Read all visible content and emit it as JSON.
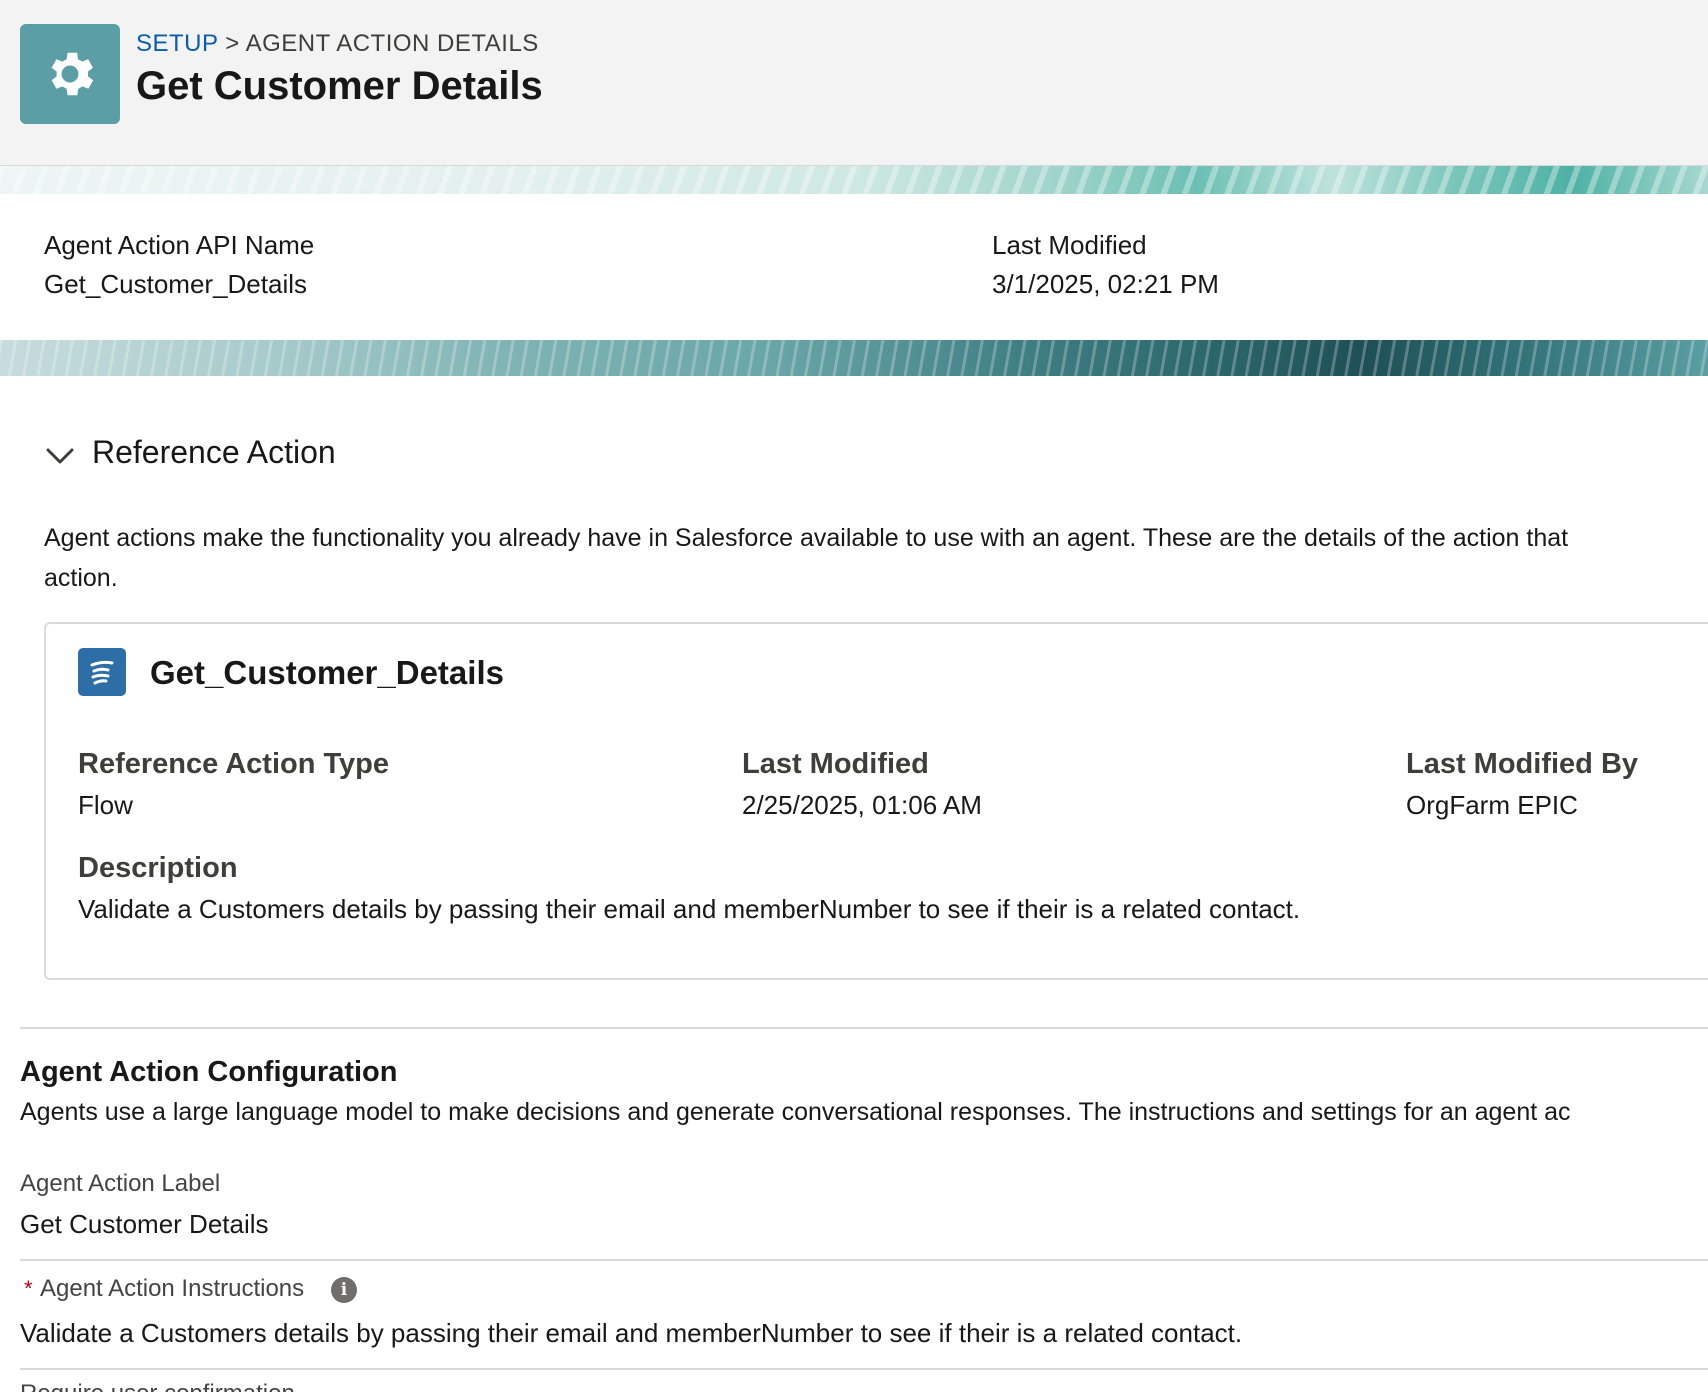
{
  "header": {
    "breadcrumb_link": "SETUP",
    "breadcrumb_separator": ">",
    "breadcrumb_current": "AGENT ACTION DETAILS",
    "title": "Get Customer Details",
    "icon": "gear-icon"
  },
  "summary": {
    "api_name_label": "Agent Action API Name",
    "api_name_value": "Get_Customer_Details",
    "last_modified_label": "Last Modified",
    "last_modified_value": "3/1/2025, 02:21 PM"
  },
  "reference_section": {
    "title": "Reference Action",
    "intro_line1": "Agent actions make the functionality you already have in Salesforce available to use with an agent. These are the details of the action that",
    "intro_line2": "action.",
    "card": {
      "icon": "flow-icon",
      "title": "Get_Customer_Details",
      "type_label": "Reference Action Type",
      "type_value": "Flow",
      "modified_label": "Last Modified",
      "modified_value": "2/25/2025, 01:06 AM",
      "modified_by_label": "Last Modified By",
      "modified_by_value": "OrgFarm EPIC",
      "description_label": "Description",
      "description_value": "Validate a Customers details by passing their email and memberNumber to see if their is a related contact."
    }
  },
  "configuration": {
    "title": "Agent Action Configuration",
    "description": "Agents use a large language model to make decisions and generate conversational responses. The instructions and settings for an agent ac",
    "label_field_label": "Agent Action Label",
    "label_field_value": "Get Customer Details",
    "instructions_required": "*",
    "instructions_label": "Agent Action Instructions",
    "instructions_value": "Validate a Customers details by passing their email and memberNumber to see if their is a related contact.",
    "next_field_label": "Require user confirmation"
  }
}
